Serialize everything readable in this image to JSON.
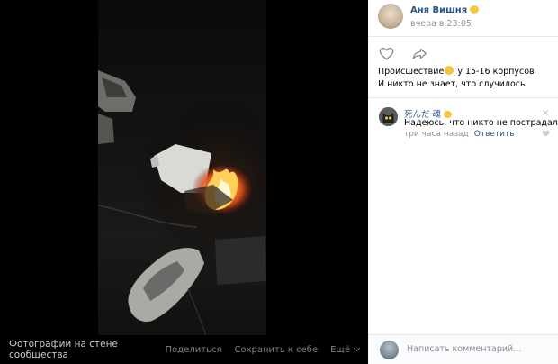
{
  "photo_viewer": {
    "caption": "Фотографии на стене сообщества",
    "actions": {
      "share": "Поделиться",
      "save": "Сохранить к себе",
      "more": "Ещё"
    }
  },
  "post": {
    "author": "Аня Вишня",
    "date": "вчера в 23:05",
    "text_line1_prefix": "Происшествие",
    "text_line1_suffix": " у 15-16 корпусов",
    "text_line2": "И никто не знает, что случилось",
    "like_icon": "heart-icon",
    "share_icon": "share-arrow-icon"
  },
  "comment": {
    "author": "死んだ 魂",
    "text": "Надеюсь, что никто не пострадал (",
    "time": "три часа назад",
    "reply": "Ответить",
    "close_icon": "×"
  },
  "footer": {
    "placeholder": "Написать комментарий..."
  },
  "colors": {
    "link": "#2a5885",
    "meta": "#939393",
    "fire": "#ff7a1a",
    "emoji": "#f3c93f"
  }
}
